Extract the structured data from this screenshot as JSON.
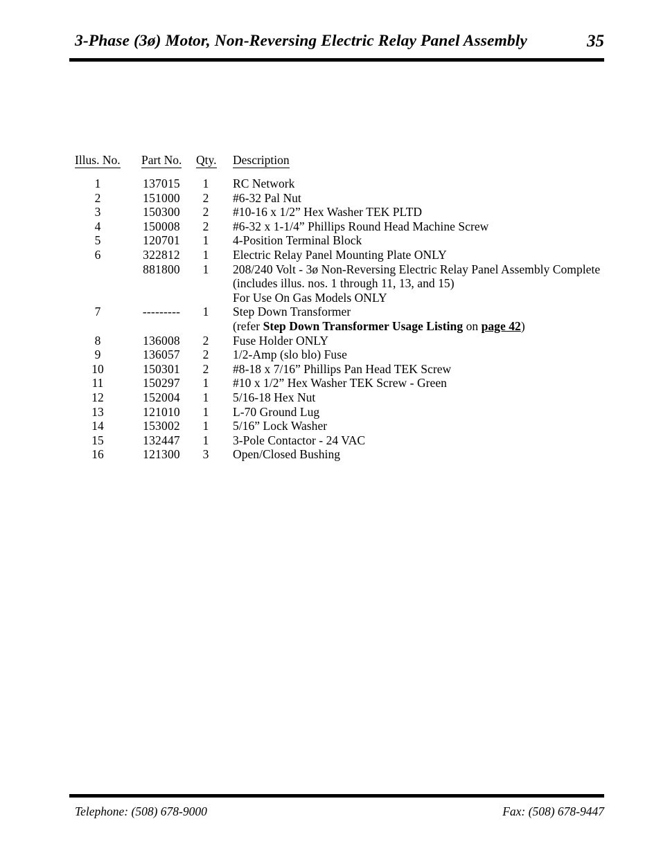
{
  "header": {
    "title": "3-Phase (3ø) Motor, Non-Reversing Electric Relay Panel Assembly",
    "page_number": "35"
  },
  "table": {
    "columns": {
      "illus": "Illus. No.",
      "part": "Part  No.",
      "qty": "Qty.",
      "description": "Description"
    },
    "rows": [
      {
        "illus": "1",
        "part": "137015",
        "qty": "1",
        "description": "RC Network"
      },
      {
        "illus": "2",
        "part": "151000",
        "qty": "2",
        "description": "#6-32 Pal Nut"
      },
      {
        "illus": "3",
        "part": "150300",
        "qty": "2",
        "description": "#10-16 x 1/2” Hex Washer TEK PLTD"
      },
      {
        "illus": "4",
        "part": "150008",
        "qty": "2",
        "description": "#6-32 x 1-1/4” Phillips Round Head Machine Screw"
      },
      {
        "illus": "5",
        "part": "120701",
        "qty": "1",
        "description": "4-Position Terminal Block"
      },
      {
        "illus": "6",
        "part": "322812",
        "qty": "1",
        "description": "Electric Relay Panel Mounting Plate ONLY"
      },
      {
        "illus": "",
        "part": "881800",
        "qty": "1",
        "description": "208/240 Volt - 3ø Non-Reversing Electric Relay Panel Assembly Complete"
      },
      {
        "illus": "",
        "part": "",
        "qty": "",
        "description": "(includes illus. nos. 1 through 11, 13, and 15)"
      },
      {
        "illus": "",
        "part": "",
        "qty": "",
        "description": "For Use On Gas Models ONLY"
      },
      {
        "illus": "7",
        "part": "---------",
        "qty": "1",
        "description": "Step Down Transformer"
      },
      {
        "illus": "",
        "part": "",
        "qty": "",
        "description": "",
        "rich": "transformer_note"
      },
      {
        "illus": "8",
        "part": "136008",
        "qty": "2",
        "description": "Fuse Holder ONLY"
      },
      {
        "illus": "9",
        "part": "136057",
        "qty": "2",
        "description": "1/2-Amp (slo blo) Fuse"
      },
      {
        "illus": "10",
        "part": "150301",
        "qty": "2",
        "description": "#8-18 x 7/16” Phillips Pan Head TEK Screw"
      },
      {
        "illus": "11",
        "part": "150297",
        "qty": "1",
        "description": "#10 x 1/2” Hex Washer TEK Screw - Green"
      },
      {
        "illus": "12",
        "part": "152004",
        "qty": "1",
        "description": "5/16-18 Hex Nut"
      },
      {
        "illus": "13",
        "part": "121010",
        "qty": "1",
        "description": "L-70 Ground Lug"
      },
      {
        "illus": "14",
        "part": "153002",
        "qty": "1",
        "description": "5/16” Lock Washer"
      },
      {
        "illus": "15",
        "part": "132447",
        "qty": "1",
        "description": "3-Pole Contactor - 24 VAC"
      },
      {
        "illus": "16",
        "part": "121300",
        "qty": "3",
        "description": "Open/Closed Bushing"
      }
    ],
    "transformer_note": {
      "prefix": "(refer ",
      "bold_title": "Step  Down  Transformer  Usage  Listing",
      "middle": " on ",
      "bold_underline_ref": "page 42",
      "suffix": ")"
    }
  },
  "footer": {
    "telephone": "Telephone: (508) 678-9000",
    "fax": "Fax: (508) 678-9447"
  }
}
